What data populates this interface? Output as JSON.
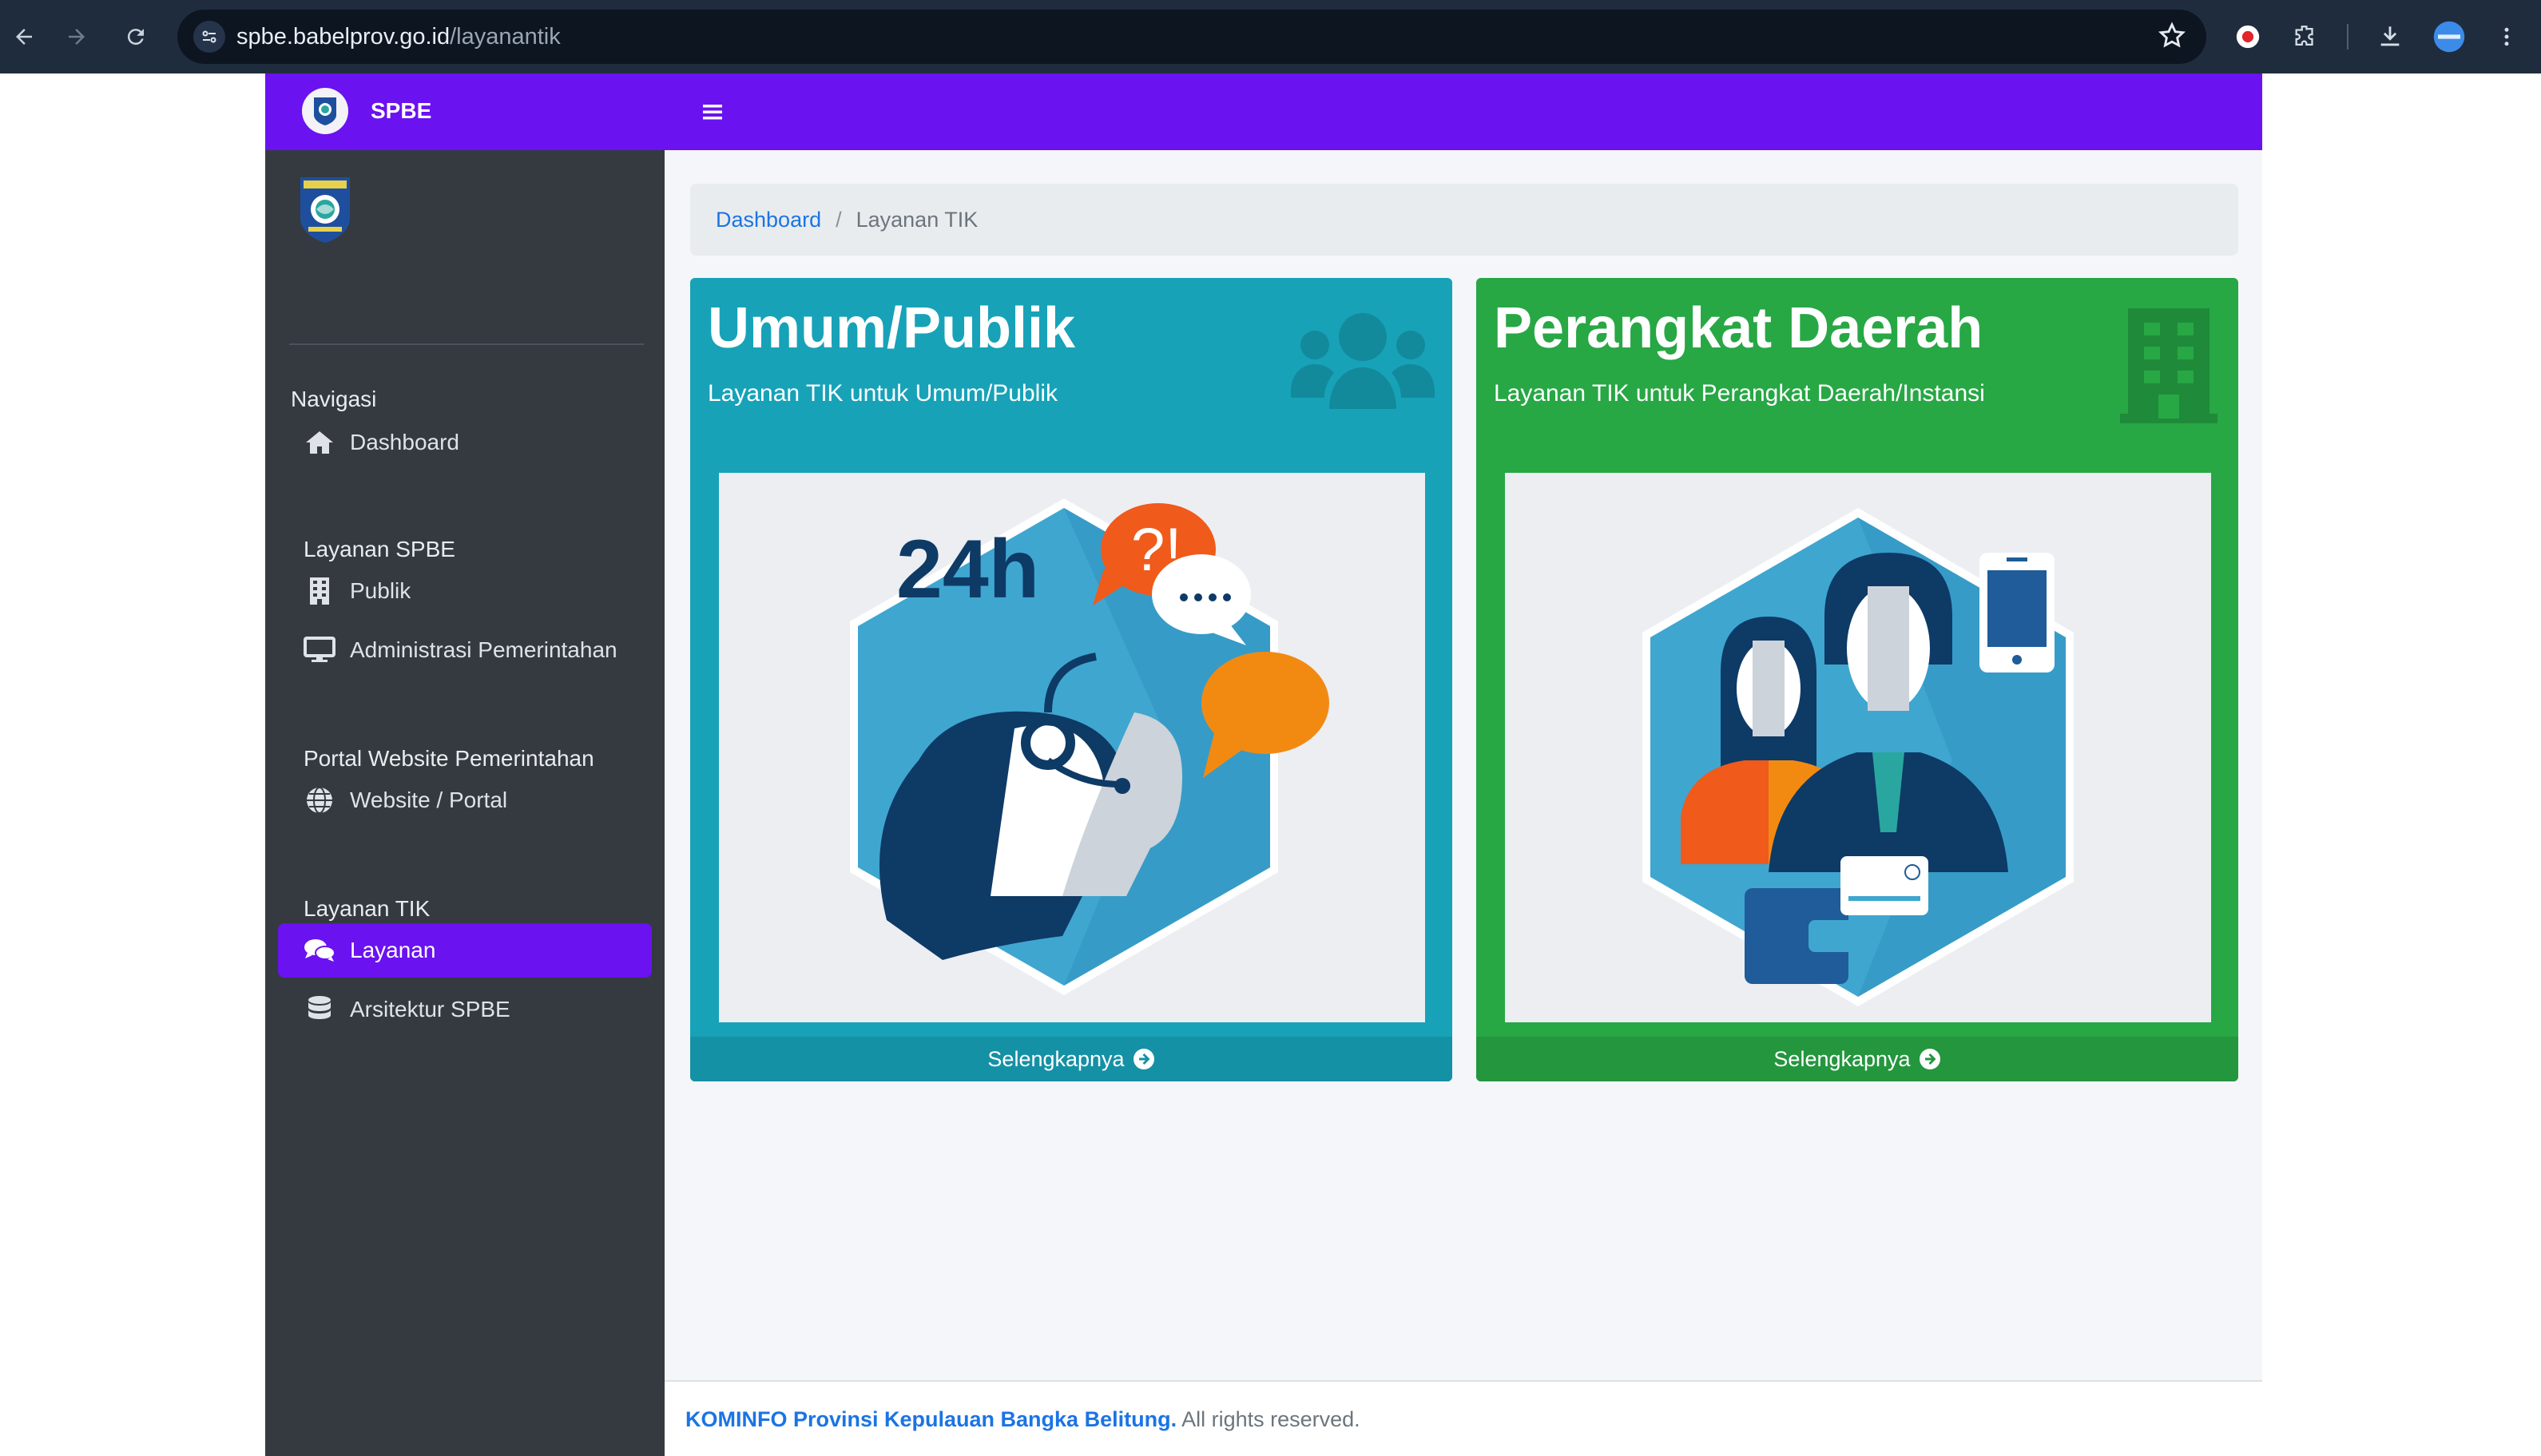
{
  "browser": {
    "url_host": "spbe.babelprov.go.id",
    "url_path": "/layanantik",
    "theme_color": "#1f2c3d"
  },
  "header": {
    "brand": "SPBE",
    "accent": "#6a12f0"
  },
  "sidebar": {
    "sections": [
      {
        "header": "Navigasi",
        "items": [
          {
            "label": "Dashboard",
            "icon": "home-icon"
          }
        ]
      },
      {
        "header": "Layanan SPBE",
        "items": [
          {
            "label": "Publik",
            "icon": "building-icon"
          },
          {
            "label": "Administrasi Pemerintahan",
            "icon": "monitor-icon"
          }
        ]
      },
      {
        "header": "Portal Website Pemerintahan",
        "items": [
          {
            "label": "Website / Portal",
            "icon": "globe-icon"
          }
        ]
      },
      {
        "header": "Layanan TIK",
        "items": [
          {
            "label": "Layanan",
            "icon": "comments-icon",
            "active": true
          },
          {
            "label": "Arsitektur SPBE",
            "icon": "database-icon"
          }
        ]
      }
    ]
  },
  "breadcrumb": {
    "home": "Dashboard",
    "current": "Layanan TIK"
  },
  "cards": [
    {
      "title": "Umum/Publik",
      "subtitle": "Layanan TIK untuk Umum/Publik",
      "icon": "users-icon",
      "color": "#17a2b8",
      "illustration_text": "24h",
      "bubble_text": "?!",
      "more": "Selengkapnya"
    },
    {
      "title": "Perangkat Daerah",
      "subtitle": "Layanan TIK untuk Perangkat Daerah/Instansi",
      "icon": "building-icon",
      "color": "#28a745",
      "more": "Selengkapnya"
    }
  ],
  "footer": {
    "org": "KOMINFO Provinsi Kepulauan Bangka Belitung.",
    "rights": "All rights reserved."
  }
}
